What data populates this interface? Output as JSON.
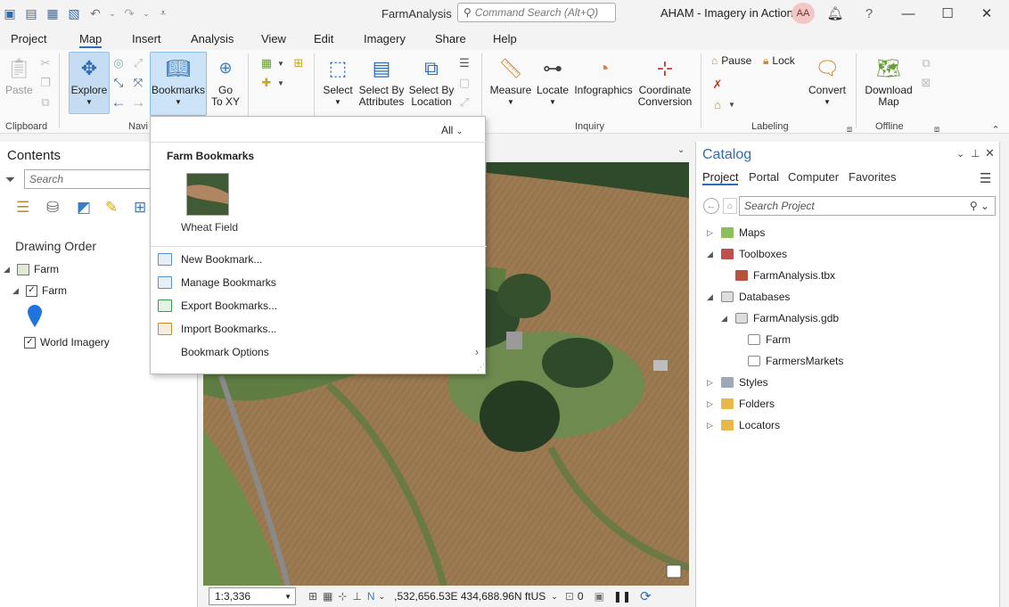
{
  "titlebar": {
    "app_title": "FarmAnalysis",
    "command_search_placeholder": "Command Search (Alt+Q)",
    "user_project": "AHAM - Imagery in Action",
    "avatar_initials": "AA",
    "help": "?"
  },
  "menu": {
    "tabs": [
      "Project",
      "Map",
      "Insert",
      "Analysis",
      "View",
      "Edit",
      "Imagery",
      "Share",
      "Help"
    ],
    "active": "Map"
  },
  "ribbon": {
    "paste": "Paste",
    "clipboard_group": "Clipboard",
    "explore": "Explore",
    "bookmarks": "Bookmarks",
    "goto_xy_1": "Go",
    "goto_xy_2": "To XY",
    "navigate_group": "Navi",
    "select": "Select",
    "select_by_attr_1": "Select By",
    "select_by_attr_2": "Attributes",
    "select_by_loc_1": "Select By",
    "select_by_loc_2": "Location",
    "measure": "Measure",
    "locate": "Locate",
    "infographics": "Infographics",
    "coord_1": "Coordinate",
    "coord_2": "Conversion",
    "inquiry_group": "Inquiry",
    "pause": "Pause",
    "lock": "Lock",
    "convert": "Convert",
    "labeling_group": "Labeling",
    "download_1": "Download",
    "download_2": "Map",
    "offline_group": "Offline"
  },
  "contents": {
    "title": "Contents",
    "search_placeholder": "Search",
    "drawing_order": "Drawing Order",
    "map_name": "Farm",
    "layer_farm": "Farm",
    "layer_imagery": "World Imagery"
  },
  "bookmarks_menu": {
    "filter": "All",
    "section": "Farm Bookmarks",
    "thumbnail_label": "Wheat Field",
    "items": [
      "New Bookmark...",
      "Manage Bookmarks",
      "Export Bookmarks...",
      "Import Bookmarks...",
      "Bookmark Options"
    ]
  },
  "statusbar": {
    "scale": "1:3,336",
    "coordinates": ",532,656.53E 434,688.96N ftUS",
    "selected_count": "0"
  },
  "catalog": {
    "title": "Catalog",
    "tabs": [
      "Project",
      "Portal",
      "Computer",
      "Favorites"
    ],
    "active_tab": "Project",
    "search_placeholder": "Search Project",
    "tree": {
      "maps": "Maps",
      "toolboxes": "Toolboxes",
      "toolbox_item": "FarmAnalysis.tbx",
      "databases": "Databases",
      "gdb": "FarmAnalysis.gdb",
      "fc_farm": "Farm",
      "fc_markets": "FarmersMarkets",
      "styles": "Styles",
      "folders": "Folders",
      "locators": "Locators"
    }
  },
  "colors": {
    "accent": "#2c6db5",
    "highlight": "#cde3f7",
    "field": "#9b7a52",
    "trees": "#2f4a2a"
  }
}
